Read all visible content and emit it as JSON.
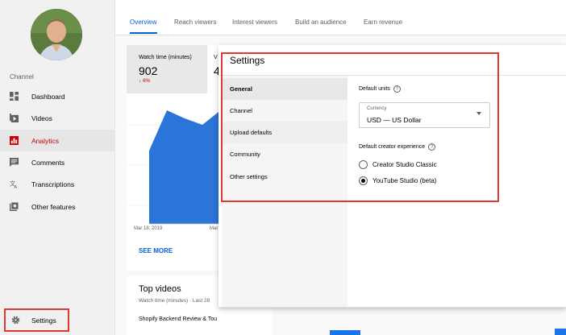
{
  "sidebar": {
    "channel_label": "Channel",
    "items": [
      {
        "label": "Dashboard",
        "icon": "dashboard-icon"
      },
      {
        "label": "Videos",
        "icon": "videos-icon"
      },
      {
        "label": "Analytics",
        "icon": "analytics-icon",
        "active": true
      },
      {
        "label": "Comments",
        "icon": "comments-icon"
      },
      {
        "label": "Transcriptions",
        "icon": "transcriptions-icon"
      },
      {
        "label": "Other features",
        "icon": "other-features-icon"
      }
    ],
    "settings_label": "Settings"
  },
  "tabs": [
    "Overview",
    "Reach viewers",
    "Interest viewers",
    "Build an audience",
    "Earn revenue"
  ],
  "overview": {
    "metric_label": "Watch time (minutes)",
    "metric_value": "902",
    "metric_delta": "6%",
    "metric2_label_fragment": "V",
    "metric2_value_fragment": "4",
    "chart_start_label": "Mar 18, 2019",
    "chart_mid_label": "Mar",
    "see_more": "SEE MORE"
  },
  "top_videos": {
    "title": "Top videos",
    "subtitle": "Watch time (minutes) · Last 28",
    "first_row": "Shopify Backend Review & Tou"
  },
  "settings_modal": {
    "title": "Settings",
    "menu": [
      "General",
      "Channel",
      "Upload defaults",
      "Community",
      "Other settings"
    ],
    "default_units_label": "Default units",
    "currency_caption": "Currency",
    "currency_value": "USD — US Dollar",
    "creator_experience_label": "Default creator experience",
    "options": [
      "Creator Studio Classic",
      "YouTube Studio (beta)"
    ],
    "selected_option": "YouTube Studio (beta)"
  },
  "colors": {
    "accent_blue": "#065fd4",
    "active_red": "#cc0000",
    "highlight_red": "#e03a2f"
  }
}
